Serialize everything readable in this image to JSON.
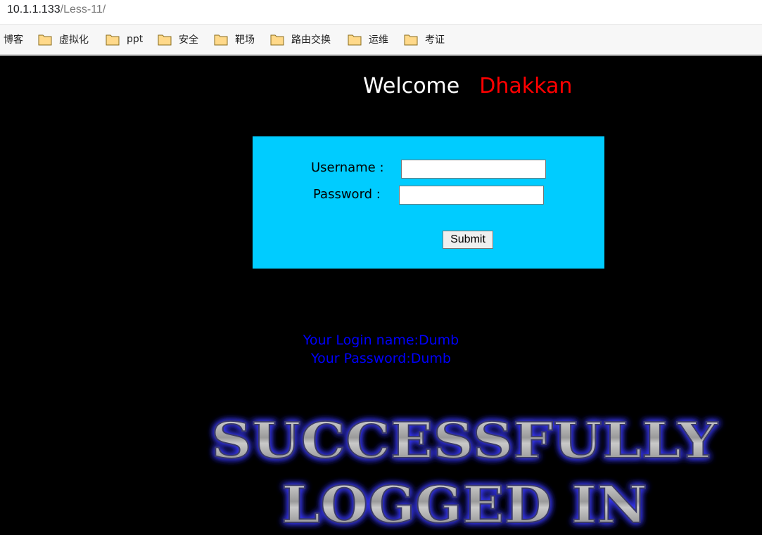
{
  "address_bar": {
    "host": "10.1.1.133",
    "path": "/Less-11/"
  },
  "bookmarks": [
    {
      "label": "博客",
      "icon": null
    },
    {
      "label": "虚拟化",
      "icon": "folder-icon"
    },
    {
      "label": "ppt",
      "icon": "folder-icon"
    },
    {
      "label": "安全",
      "icon": "folder-icon"
    },
    {
      "label": "靶场",
      "icon": "folder-icon"
    },
    {
      "label": "路由交换",
      "icon": "folder-icon"
    },
    {
      "label": "运维",
      "icon": "folder-icon"
    },
    {
      "label": "考证",
      "icon": "folder-icon"
    }
  ],
  "page": {
    "welcome": "Welcome",
    "welcome_name": "Dhakkan",
    "form": {
      "username_label": "Username :",
      "username_value": "",
      "password_label": "Password :",
      "password_value": "",
      "submit_label": "Submit"
    },
    "result": {
      "login_name": "Your Login name:Dumb",
      "password": "Your Password:Dumb"
    },
    "banner": {
      "line1": "SUCCESSFULLY",
      "line2": "LOGGED IN"
    }
  },
  "colors": {
    "page_background": "#000000",
    "form_background": "#00ccff",
    "welcome_name": "#ff0000",
    "result_text": "#0000ff",
    "folder_icon": "#ffd98a"
  }
}
